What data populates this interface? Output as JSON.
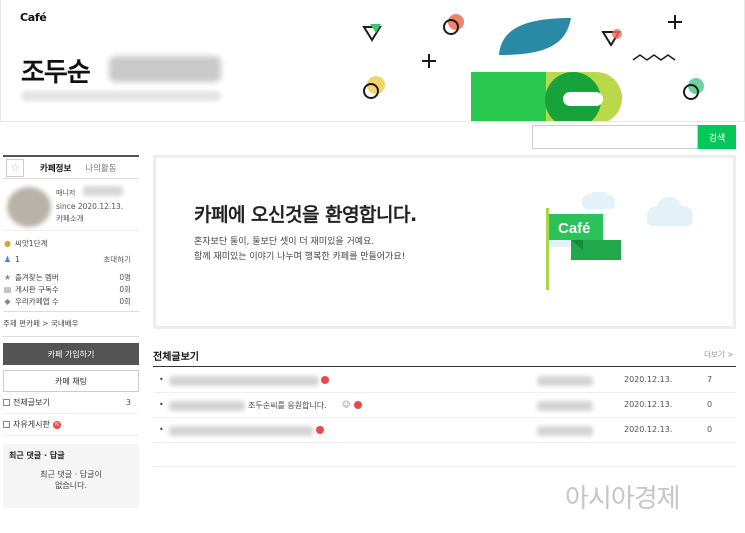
{
  "header": {
    "logo": "Café",
    "title": "조두순"
  },
  "search": {
    "placeholder": "",
    "button": "검색"
  },
  "sidebar": {
    "tab_info": "카페정보",
    "tab_activity": "나의활동",
    "manager_label": "매니저",
    "since": "since 2020.12.13.",
    "intro_link": "카페소개",
    "level": "씨앗1단계",
    "members_count": "1",
    "invite": "초대하기",
    "stats": [
      {
        "label": "즐겨찾는 멤버",
        "value": "0명"
      },
      {
        "label": "게시판 구독수",
        "value": "0회"
      },
      {
        "label": "우리카페앱 수",
        "value": "0회"
      }
    ],
    "topic": "주제 편카페 > 국내배우",
    "join_button": "카페 가입하기",
    "chat_button": "카페 채팅",
    "menu": [
      {
        "label": "전체글보기",
        "count": "3"
      },
      {
        "label": "자유게시판",
        "count": ""
      }
    ],
    "recent_title": "최근 댓글 · 답글",
    "recent_empty_1": "최근 댓글 · 답글이",
    "recent_empty_2": "없습니다."
  },
  "welcome": {
    "title": "카페에 오신것을 환영합니다.",
    "line1": "혼자보단 둘이, 둘보단 셋이 더 재미있을 거예요.",
    "line2": "함께 재미있는 이야기 나누며 행복한 카페를 만들어가요!",
    "flag_label": "Café"
  },
  "posts": {
    "title": "전체글보기",
    "more": "더보기 >",
    "rows": [
      {
        "title_text": "",
        "date": "2020.12.13.",
        "views": "7"
      },
      {
        "title_text": "조두순씨를 응원합니다.",
        "date": "2020.12.13.",
        "views": "0"
      },
      {
        "title_text": "",
        "date": "2020.12.13.",
        "views": "0"
      }
    ]
  },
  "watermark": "아시아경제",
  "colors": {
    "accent": "#03c75a",
    "badge": "#e84a4a",
    "teal": "#2a8aa6"
  }
}
